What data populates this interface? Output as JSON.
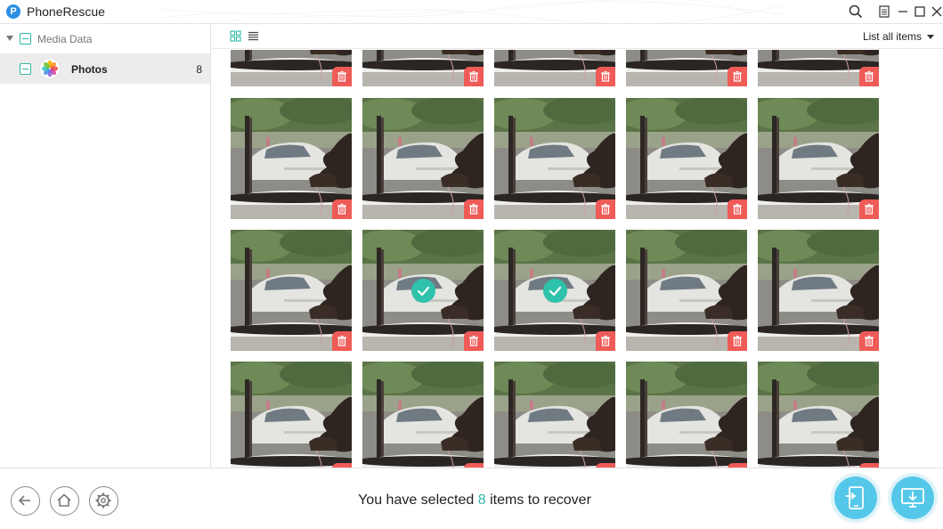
{
  "app": {
    "title": "PhoneRescue",
    "logo_letter": "P"
  },
  "window_controls": [
    "search-icon",
    "menu-icon",
    "minimize-icon",
    "maximize-icon",
    "close-icon"
  ],
  "sidebar": {
    "category": {
      "label": "Media Data",
      "expanded": true
    },
    "items": [
      {
        "label": "Photos",
        "count": "8",
        "selected": true
      }
    ]
  },
  "toolbar": {
    "views": [
      "grid-view-icon",
      "list-view-icon"
    ],
    "filter_label": "List all items"
  },
  "gallery": {
    "rows": 4,
    "columns": 5,
    "checked_items": [
      {
        "row": 2,
        "col": 1
      },
      {
        "row": 2,
        "col": 2
      }
    ]
  },
  "footer": {
    "status_prefix": "You have selected",
    "status_count": "8",
    "status_suffix": "items to recover",
    "nav_buttons": [
      "back-icon",
      "home-icon",
      "settings-icon"
    ],
    "action_buttons": [
      "recover-to-device-icon",
      "recover-to-computer-icon"
    ]
  },
  "colors": {
    "accent": "#2ec2ab",
    "trash": "#ef5b57",
    "action": "#55c8e9"
  }
}
